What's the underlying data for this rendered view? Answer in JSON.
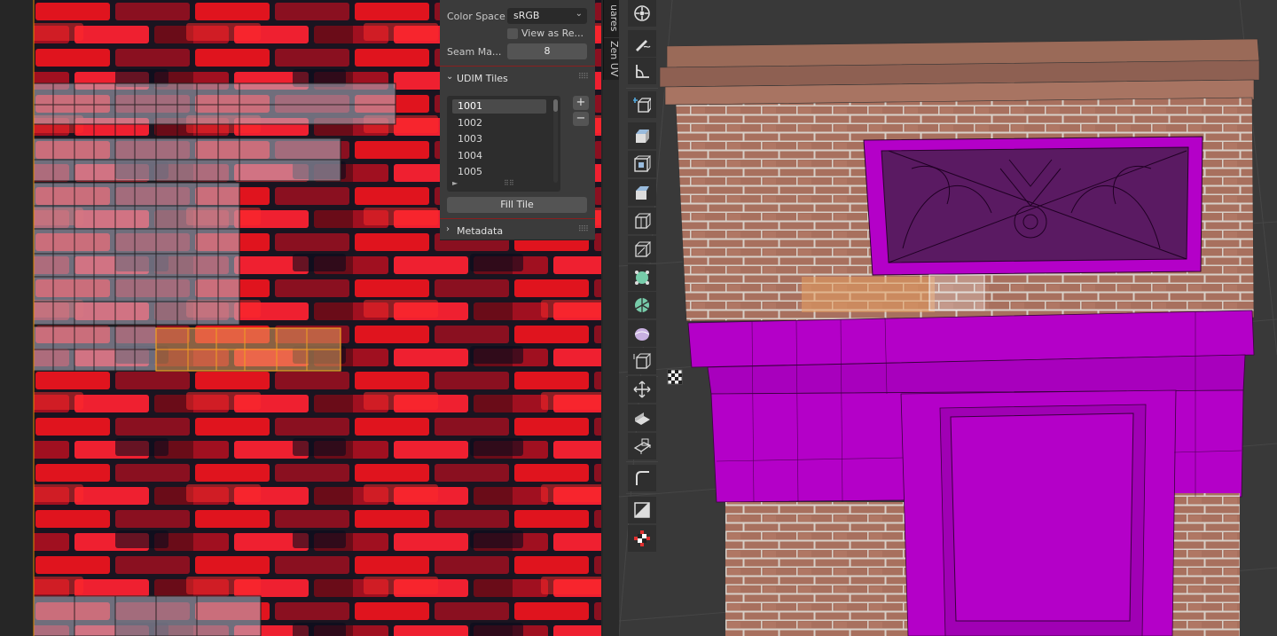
{
  "uv_editor": {
    "side_tabs": {
      "tab_1": "uares",
      "tab_2": "Zen UV"
    }
  },
  "n_panel": {
    "color_space": {
      "label": "Color Space",
      "value": "sRGB"
    },
    "view_as_render": {
      "label": "View as Re...",
      "checked": false
    },
    "seam_margin": {
      "label": "Seam Ma...",
      "value": "8"
    },
    "udim_tiles": {
      "title": "UDIM Tiles",
      "tiles": [
        "1001",
        "1002",
        "1003",
        "1004",
        "1005"
      ],
      "selected": "1001",
      "add_label": "+",
      "remove_label": "−",
      "fill_label": "Fill Tile"
    },
    "metadata": {
      "title": "Metadata"
    }
  },
  "viewport": {
    "tools": [
      "transform-icon",
      "annotate-icon",
      "measure-icon",
      "add-cube-icon",
      "extrude-region-icon",
      "inset-faces-icon",
      "bevel-icon",
      "loop-cut-icon",
      "knife-icon",
      "poly-build-icon",
      "spin-icon",
      "smooth-icon",
      "edge-slide-icon",
      "shrink-fatten-icon",
      "shear-icon",
      "rip-region-icon",
      "vertex-slide-icon",
      "uv-checker-icon",
      "zen-uv-icon"
    ],
    "colors": {
      "selected_face": "#b400c8",
      "active_tool": "#4772b3"
    }
  }
}
